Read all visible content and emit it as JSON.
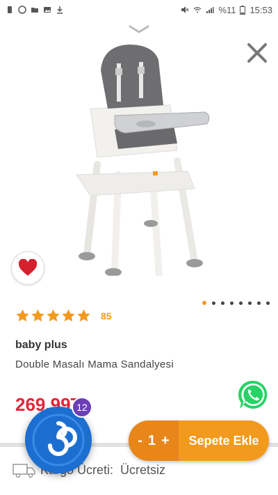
{
  "status_bar": {
    "battery_percent": "%11",
    "time": "15:53"
  },
  "product": {
    "rating_stars": 5,
    "rating_count": "85",
    "brand": "baby plus",
    "name": "Double Masalı Mama Sandalyesi",
    "price": "269,99TL"
  },
  "gallery": {
    "dot_count": 8,
    "active_index": 0
  },
  "cart": {
    "minus_label": "-",
    "quantity": "1",
    "plus_label": "+",
    "add_label": "Sepete Ekle"
  },
  "shipping": {
    "label": "Kargo Ücreti:",
    "value": "Ücretsiz"
  },
  "assistant": {
    "badge_count": "12"
  },
  "colors": {
    "accent": "#f29a1e",
    "price": "#e4263a",
    "whatsapp": "#25d366",
    "assistant": "#1c6fd1"
  }
}
